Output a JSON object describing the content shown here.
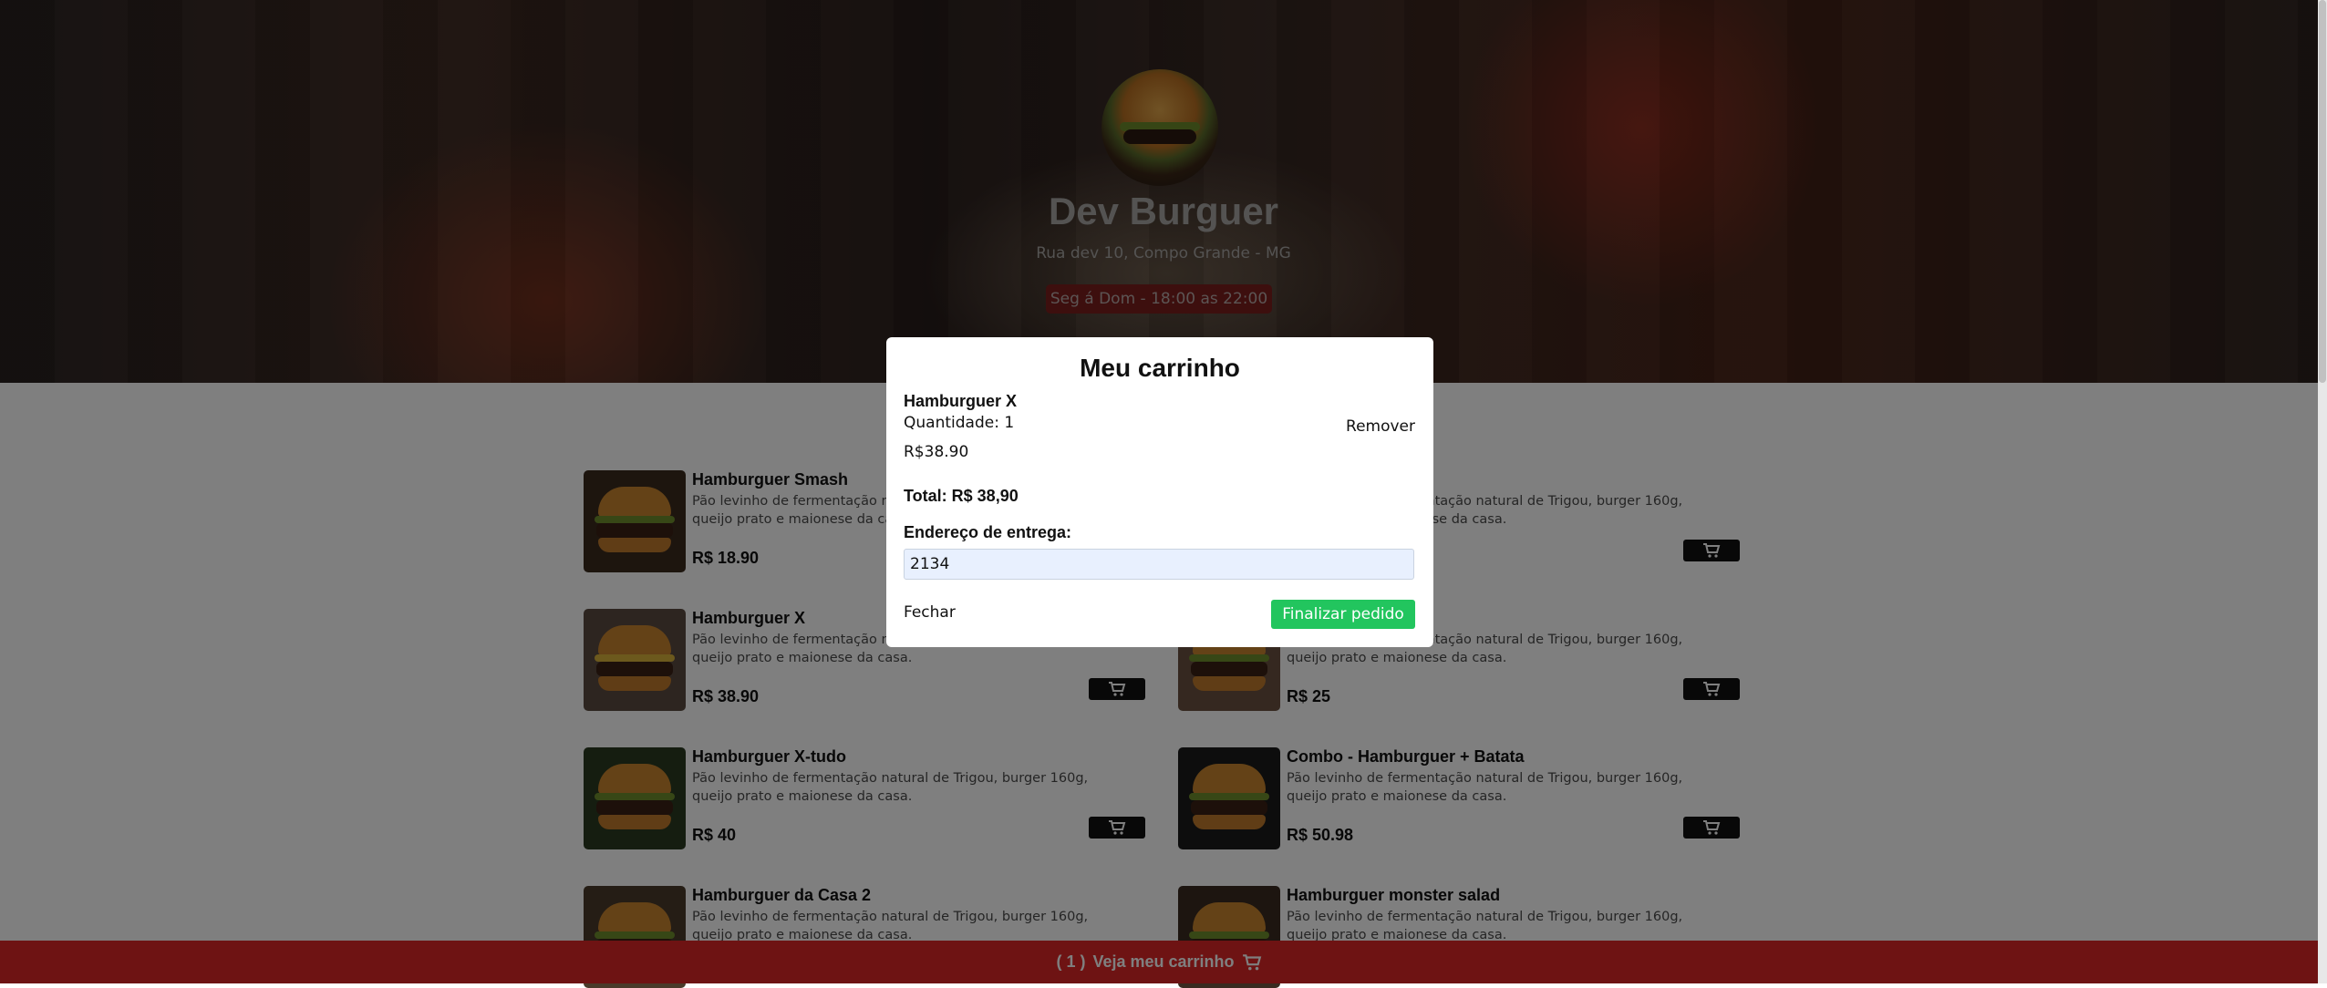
{
  "header": {
    "title": "Dev Burguer",
    "address": "Rua dev 10, Compo Grande - MG",
    "hours": "Seg á Dom - 18:00 as 22:00"
  },
  "menu": {
    "items": [
      {
        "name": "Hamburguer Smash",
        "description": "Pão levinho de fermentação natural de Trigou, burger 160g, queijo prato e maionese da casa.",
        "price": "R$ 18.90"
      },
      {
        "name": "",
        "description": "Pão levinho de fermentação natural de Trigou, burger 160g, queijo prato e maionese da casa.",
        "price": ""
      },
      {
        "name": "Hamburguer X",
        "description": "Pão levinho de fermentação natural de Trigou, burger 160g, queijo prato e maionese da casa.",
        "price": "R$ 38.90"
      },
      {
        "name": "",
        "description": "Pão levinho de fermentação natural de Trigou, burger 160g, queijo prato e maionese da casa.",
        "price": "R$ 25"
      },
      {
        "name": "Hamburguer X-tudo",
        "description": "Pão levinho de fermentação natural de Trigou, burger 160g, queijo prato e maionese da casa.",
        "price": "R$ 40"
      },
      {
        "name": "Combo - Hamburguer + Batata",
        "description": "Pão levinho de fermentação natural de Trigou, burger 160g, queijo prato e maionese da casa.",
        "price": "R$ 50.98"
      },
      {
        "name": "Hamburguer da Casa 2",
        "description": "Pão levinho de fermentação natural de Trigou, burger 160g, queijo prato e maionese da casa.",
        "price": ""
      },
      {
        "name": "Hamburguer monster salad",
        "description": "Pão levinho de fermentação natural de Trigou, burger 160g, queijo prato e maionese da casa.",
        "price": ""
      }
    ],
    "add_to_cart_icon": "cart-icon"
  },
  "cart_modal": {
    "title": "Meu carrinho",
    "item": {
      "name": "Hamburguer X",
      "quantity": "Quantidade: 1",
      "price": "R$38.90",
      "remove_label": "Remover"
    },
    "total": "Total: R$ 38,90",
    "address_label": "Endereço de entrega:",
    "address_value": "2134",
    "close_label": "Fechar",
    "finish_label": "Finalizar pedido"
  },
  "footer": {
    "count": "( 1 )",
    "label": "Veja meu carrinho",
    "icon": "cart-icon"
  },
  "colors": {
    "footer_bg": "#dc2626",
    "finish_button": "#22c55e",
    "hours_badge": "#dc2626",
    "cart_button": "#111111"
  }
}
